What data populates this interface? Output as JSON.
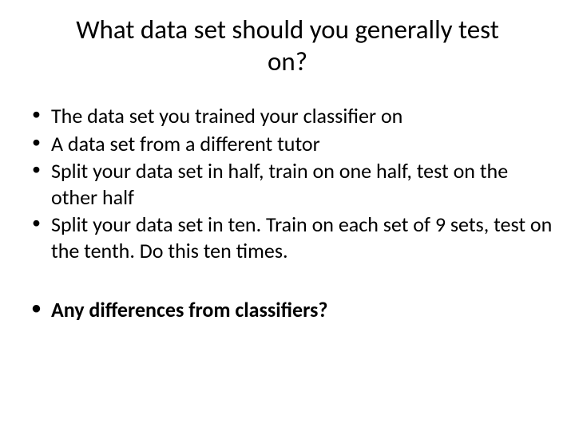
{
  "slide": {
    "title": "What data set should you generally test on?",
    "bullets": [
      "The data set you trained your classifier on",
      "A data set from a different tutor",
      "Split your data set in half, train on one half, test on the other half",
      "Split your data set in ten. Train on each set of 9 sets, test on the tenth. Do this ten times."
    ],
    "final_bullet": "Any differences from classifiers?"
  }
}
